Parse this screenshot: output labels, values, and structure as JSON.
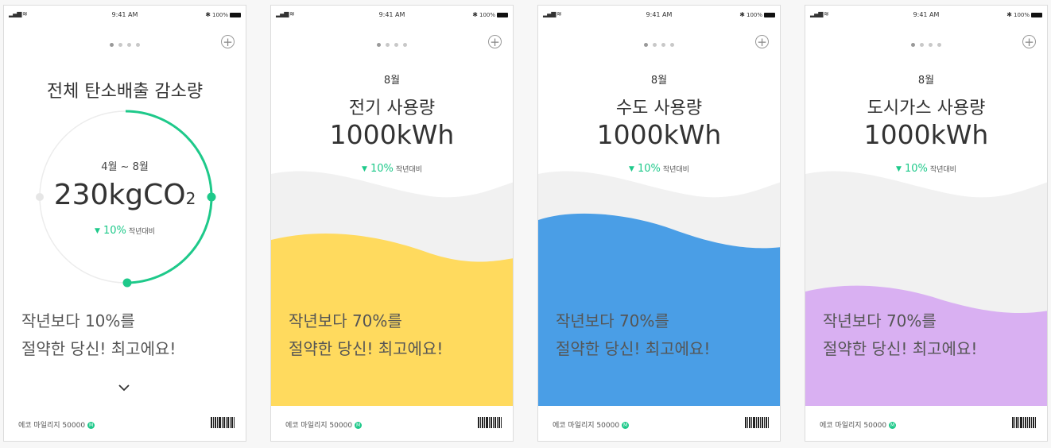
{
  "status": {
    "time": "9:41 AM",
    "battery": "100%"
  },
  "screens": [
    {
      "title": "전체 탄소배출 감소량",
      "period": "4월 ~ 8월",
      "amount": "230kgCO",
      "amount_sub": "2",
      "change": "10%",
      "change_label": "작년대비",
      "message_line1": "작년보다 10%를",
      "message_line2": "절약한 당신! 최고에요!",
      "mileage_label": "에코 마일리지",
      "mileage_value": "50000",
      "accent": "#1ec98a"
    },
    {
      "month": "8월",
      "utility": "전기 사용량",
      "amount": "1000kWh",
      "change": "10%",
      "change_label": "작년대비",
      "message_line1": "작년보다 70%를",
      "message_line2": "절약한 당신! 최고에요!",
      "mileage_label": "에코 마일리지",
      "mileage_value": "50000",
      "color": "#ffda5e"
    },
    {
      "month": "8월",
      "utility": "수도 사용량",
      "amount": "1000kWh",
      "change": "10%",
      "change_label": "작년대비",
      "message_line1": "작년보다 70%를",
      "message_line2": "절약한 당신! 최고에요!",
      "mileage_label": "에코 마일리지",
      "mileage_value": "50000",
      "color": "#4a9ee6"
    },
    {
      "month": "8월",
      "utility": "도시가스 사용량",
      "amount": "1000kWh",
      "change": "10%",
      "change_label": "작년대비",
      "message_line1": "작년보다 70%를",
      "message_line2": "절약한 당신! 최고에요!",
      "mileage_label": "에코 마일리지",
      "mileage_value": "50000",
      "color": "#d9b0f2"
    }
  ]
}
